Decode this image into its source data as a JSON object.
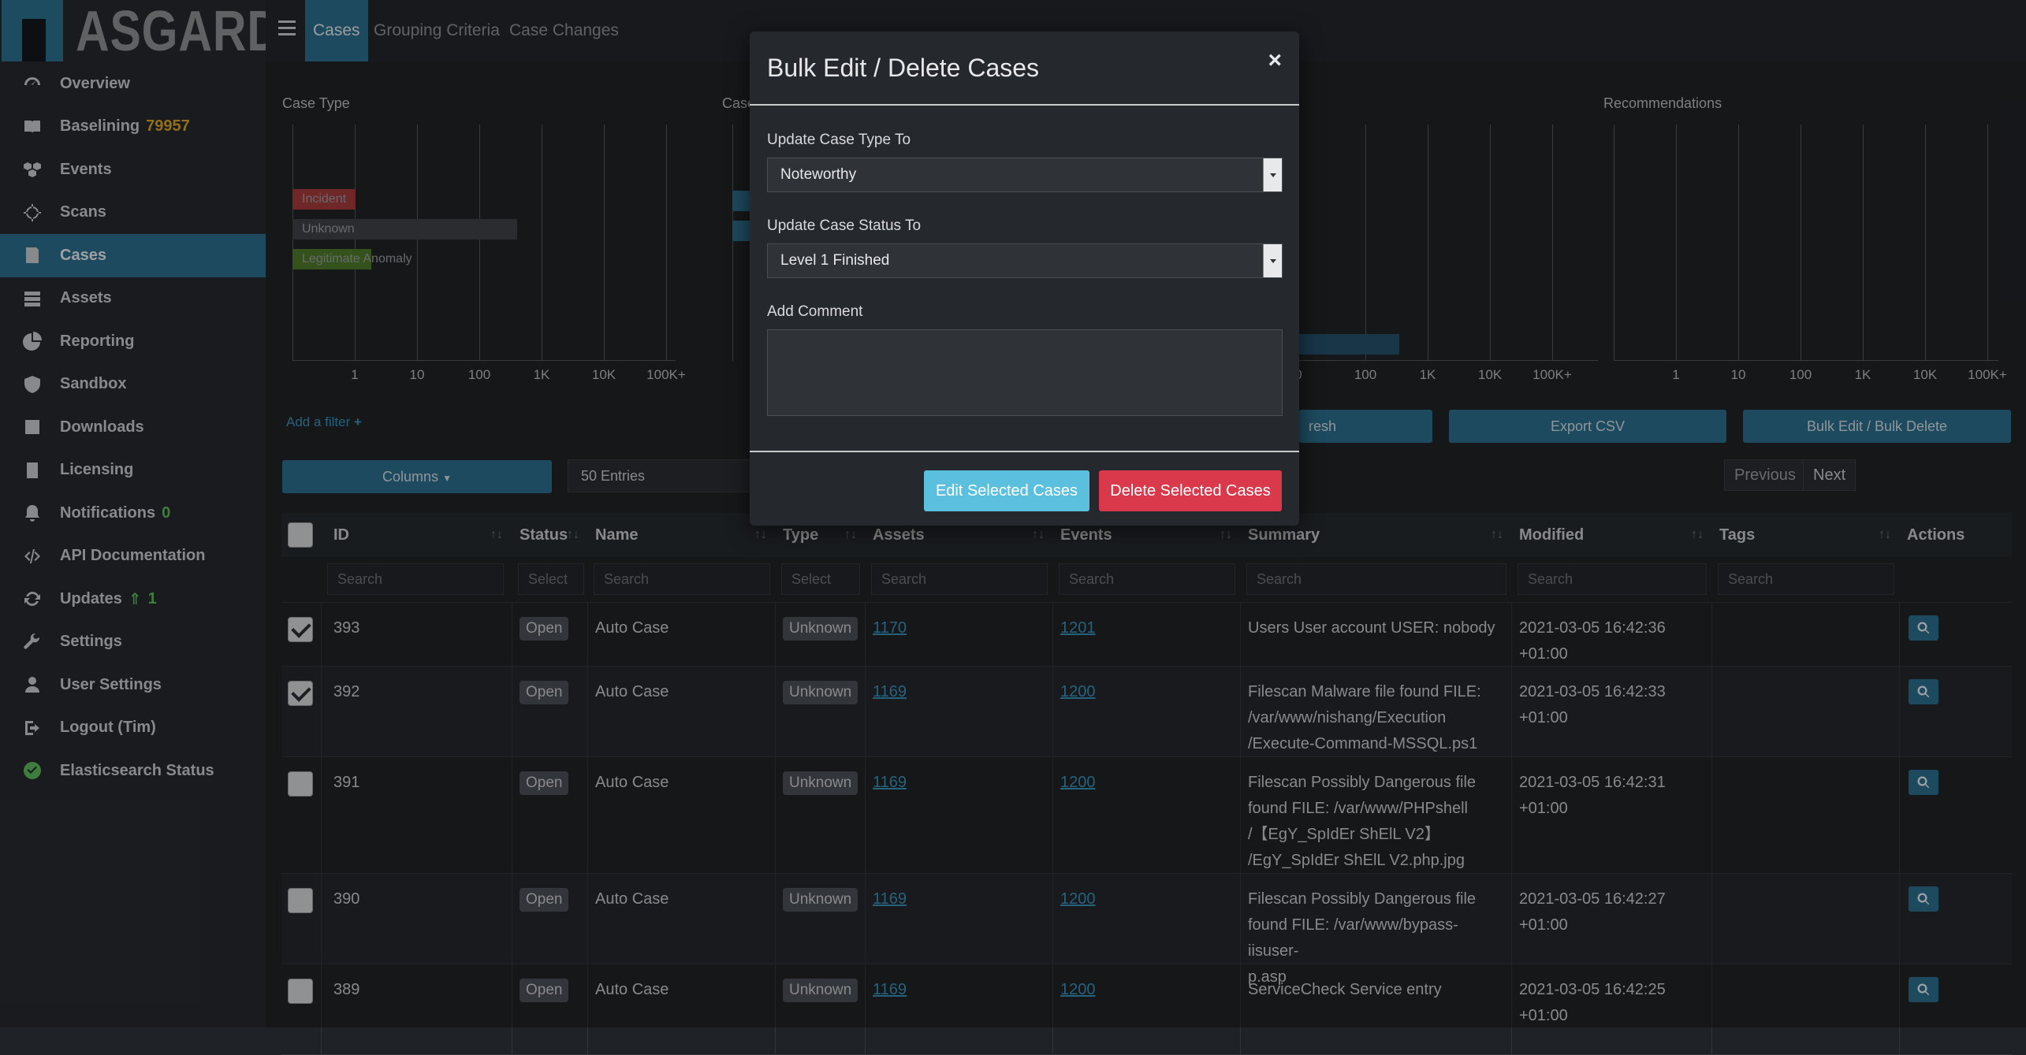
{
  "app": {
    "logo_text": "ASGARD"
  },
  "sidebar": {
    "items": [
      {
        "label": "Overview",
        "icon": "dashboard-icon"
      },
      {
        "label": "Baselining",
        "count": "79957",
        "icon": "book-icon"
      },
      {
        "label": "Events",
        "icon": "cubes-icon"
      },
      {
        "label": "Scans",
        "icon": "crosshair-icon"
      },
      {
        "label": "Cases",
        "icon": "case-icon",
        "active": true
      },
      {
        "label": "Assets",
        "icon": "server-icon"
      },
      {
        "label": "Reporting",
        "icon": "pie-chart-icon"
      },
      {
        "label": "Sandbox",
        "icon": "shield-icon"
      },
      {
        "label": "Downloads",
        "icon": "download-box-icon"
      },
      {
        "label": "Licensing",
        "icon": "license-icon"
      },
      {
        "label": "Notifications",
        "count": "0",
        "icon": "bell-icon"
      },
      {
        "label": "API Documentation",
        "icon": "code-icon"
      },
      {
        "label": "Updates",
        "count": "1",
        "icon": "sync-icon"
      },
      {
        "label": "Settings",
        "icon": "wrench-icon"
      },
      {
        "label": "User Settings",
        "icon": "user-icon"
      },
      {
        "label": "Logout (Tim)",
        "icon": "logout-icon"
      },
      {
        "label": "Elasticsearch Status",
        "icon": "check-circle-icon"
      }
    ]
  },
  "topbar": {
    "tabs": [
      "Cases",
      "Grouping Criteria",
      "Case Changes"
    ]
  },
  "charts": {
    "case_type": {
      "title": "Case Type",
      "ticks": [
        "1",
        "10",
        "100",
        "1K",
        "10K",
        "100K+"
      ],
      "bars": [
        {
          "label": "Incident",
          "color": "#a53a3a"
        },
        {
          "label": "Unknown",
          "color": "#3f4246"
        },
        {
          "label": "Legitimate Anomaly",
          "color": "#4f7a2c"
        }
      ]
    },
    "case_status": {
      "title": "Case"
    },
    "recommendations": {
      "title": "Recommendations",
      "ticks": [
        "1",
        "10",
        "100",
        "1K",
        "10K",
        "100K+"
      ]
    },
    "middle_ticks": [
      "0",
      "100",
      "1K",
      "10K",
      "100K+"
    ]
  },
  "add_filter": "Add a filter",
  "controls": {
    "columns": "Columns",
    "entries": "50 Entries",
    "refresh": "resh",
    "export": "Export CSV",
    "bulk": "Bulk Edit / Bulk Delete",
    "previous": "Previous",
    "next": "Next"
  },
  "table": {
    "headers": [
      "ID",
      "Status",
      "Name",
      "Type",
      "Assets",
      "Events",
      "Summary",
      "Modified",
      "Tags",
      "Actions"
    ],
    "search_placeholders": {
      "id": "Search",
      "status": "Select",
      "name": "Search",
      "type": "Select",
      "assets": "Search",
      "events": "Search",
      "summary": "Search",
      "modified": "Search",
      "tags": "Search"
    },
    "rows": [
      {
        "checked": true,
        "id": "393",
        "status": "Open",
        "name": "Auto Case",
        "type": "Unknown",
        "assets": "1170",
        "events": "1201",
        "summary": [
          "Users User account USER: nobody"
        ],
        "modified": [
          "2021-03-05 16:42:36",
          "+01:00"
        ]
      },
      {
        "checked": true,
        "id": "392",
        "status": "Open",
        "name": "Auto Case",
        "type": "Unknown",
        "assets": "1169",
        "events": "1200",
        "summary": [
          "Filescan Malware file found FILE:",
          "/var/www/nishang/Execution",
          "/Execute-Command-MSSQL.ps1"
        ],
        "modified": [
          "2021-03-05 16:42:33",
          "+01:00"
        ]
      },
      {
        "checked": false,
        "id": "391",
        "status": "Open",
        "name": "Auto Case",
        "type": "Unknown",
        "assets": "1169",
        "events": "1200",
        "summary": [
          "Filescan Possibly Dangerous file",
          "found FILE: /var/www/PHPshell",
          "/【EgY_SpIdEr ShElL V2】",
          "/EgY_SpIdEr ShElL V2.php.jpg"
        ],
        "modified": [
          "2021-03-05 16:42:31",
          "+01:00"
        ]
      },
      {
        "checked": false,
        "id": "390",
        "status": "Open",
        "name": "Auto Case",
        "type": "Unknown",
        "assets": "1169",
        "events": "1200",
        "summary": [
          "Filescan Possibly Dangerous file",
          "found FILE: /var/www/bypass-iisuser-",
          "p.asp"
        ],
        "modified": [
          "2021-03-05 16:42:27",
          "+01:00"
        ]
      },
      {
        "checked": false,
        "id": "389",
        "status": "Open",
        "name": "Auto Case",
        "type": "Unknown",
        "assets": "1169",
        "events": "1200",
        "summary": [
          "ServiceCheck Service entry"
        ],
        "modified": [
          "2021-03-05 16:42:25",
          "+01:00"
        ]
      }
    ]
  },
  "modal": {
    "title": "Bulk Edit / Delete Cases",
    "close": "×",
    "type_label": "Update Case Type To",
    "type_value": "Noteworthy",
    "status_label": "Update Case Status To",
    "status_value": "Level 1 Finished",
    "comment_label": "Add Comment",
    "edit_button": "Edit Selected Cases",
    "delete_button": "Delete Selected Cases"
  },
  "colors": {
    "accent": "#2c6d8b",
    "edit": "#5bc0de",
    "delete": "#d9394b",
    "gold": "#d7a523",
    "green": "#5cb85c"
  }
}
